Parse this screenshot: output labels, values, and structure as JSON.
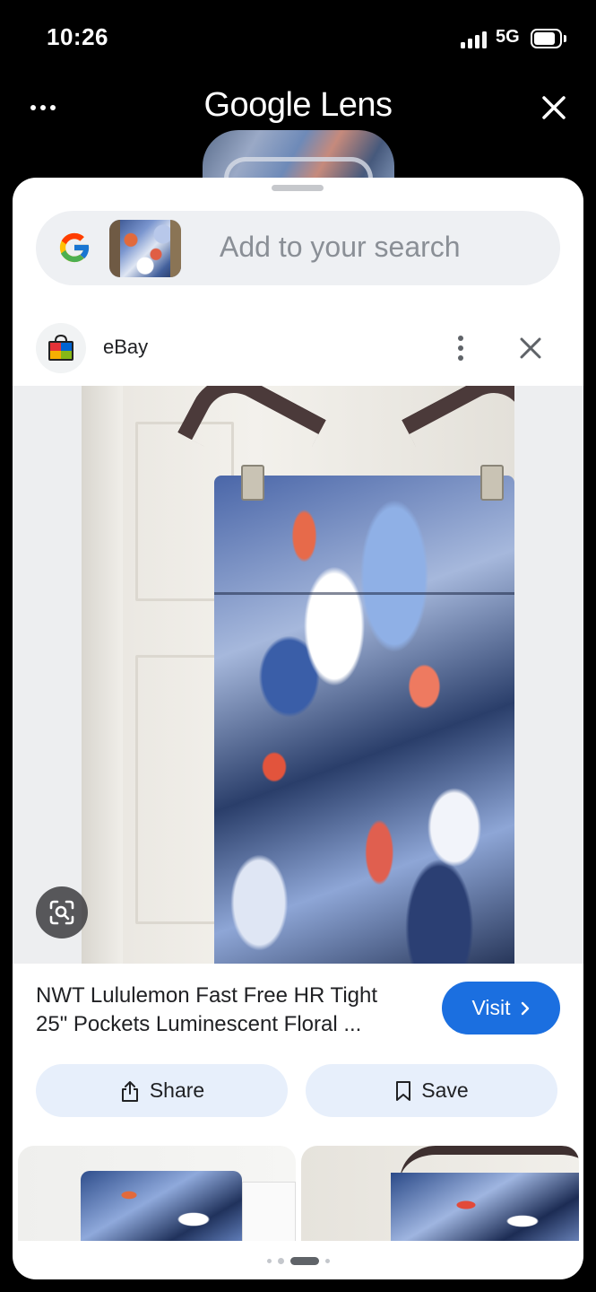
{
  "status_bar": {
    "time": "10:26",
    "network": "5G",
    "icons": [
      "signal-icon",
      "battery-icon"
    ]
  },
  "header": {
    "title": "Google Lens",
    "more_icon": "more-horizontal-icon",
    "close_icon": "close-icon"
  },
  "search": {
    "placeholder": "Add to your search",
    "logo": "google-g-logo",
    "thumbnail": "selected-region-thumbnail"
  },
  "result": {
    "source": "eBay",
    "source_icon": "ebay-shopping-bag-icon",
    "title_line1": "NWT Lululemon Fast Free HR Tight",
    "title_line2": "25\" Pockets Luminescent Floral ...",
    "visit_label": "Visit",
    "share_label": "Share",
    "save_label": "Save",
    "image_description_icon": "lens-search-icon"
  },
  "pager": {
    "pages": 4,
    "active_index": 2
  },
  "colors": {
    "accent": "#1b6fe0",
    "action_bg": "#e7effb",
    "sheet_bg": "#ffffff",
    "search_bg": "#eef0f3"
  }
}
